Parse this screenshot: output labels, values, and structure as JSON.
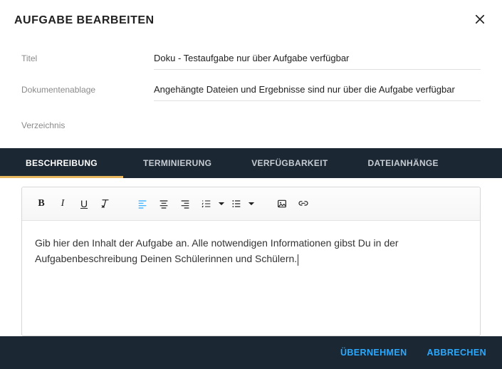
{
  "header": {
    "title": "AUFGABE BEARBEITEN"
  },
  "form": {
    "titel_label": "Titel",
    "titel_value": "Doku - Testaufgabe nur über Aufgabe verfügbar",
    "ablage_label": "Dokumentenablage",
    "ablage_value": "Angehängte Dateien und Ergebnisse sind nur über die Aufgabe verfügbar",
    "verzeichnis_label": "Verzeichnis",
    "verzeichnis_value": ""
  },
  "tabs": {
    "beschreibung": "BESCHREIBUNG",
    "terminierung": "TERMINIERUNG",
    "verfuegbarkeit": "VERFÜGBARKEIT",
    "dateianhaenge": "DATEIANHÄNGE",
    "active": "beschreibung"
  },
  "editor": {
    "content": "Gib hier den Inhalt der Aufgabe an. Alle notwendigen Informationen gibst Du in der Aufgabenbeschreibung Deinen Schülerinnen und Schülern."
  },
  "footer": {
    "uebernehmen": "ÜBERNEHMEN",
    "abbrechen": "ABBRECHEN"
  },
  "icons": {
    "bold": "B",
    "italic": "I",
    "underline": "U"
  }
}
